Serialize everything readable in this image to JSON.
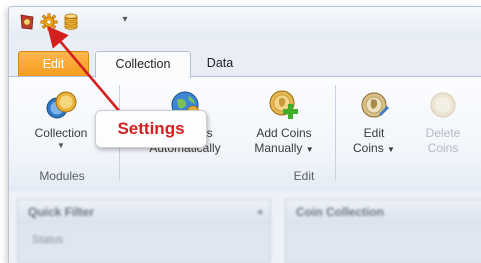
{
  "qat": {
    "items": [
      "app-icon",
      "settings-icon",
      "database-icon"
    ],
    "dropdown_glyph": "▾"
  },
  "tabs": [
    {
      "label": "Edit",
      "active": false,
      "accent": "#f39a1c"
    },
    {
      "label": "Collection",
      "active": true
    },
    {
      "label": "Data",
      "active": false
    }
  ],
  "ribbon": {
    "modules": {
      "group_label": "Modules",
      "buttons": [
        {
          "label": "Collection",
          "dropdown": true
        }
      ]
    },
    "edit": {
      "group_label": "Edit",
      "buttons": [
        {
          "line1": "Add Coins",
          "line2": "Automatically",
          "dropdown": false,
          "enabled": true
        },
        {
          "line1": "Add Coins",
          "line2": "Manually",
          "dropdown": true,
          "enabled": true
        },
        {
          "line1": "Edit",
          "line2": "Coins",
          "dropdown": true,
          "enabled": true
        },
        {
          "line1": "Delete",
          "line2": "Coins",
          "dropdown": false,
          "enabled": false
        }
      ]
    }
  },
  "callout": {
    "text": "Settings",
    "color": "#d41f1f"
  },
  "panes": {
    "left": {
      "title": "Quick Filter",
      "sub": "Status"
    },
    "right": {
      "title": "Coin Collection"
    }
  }
}
